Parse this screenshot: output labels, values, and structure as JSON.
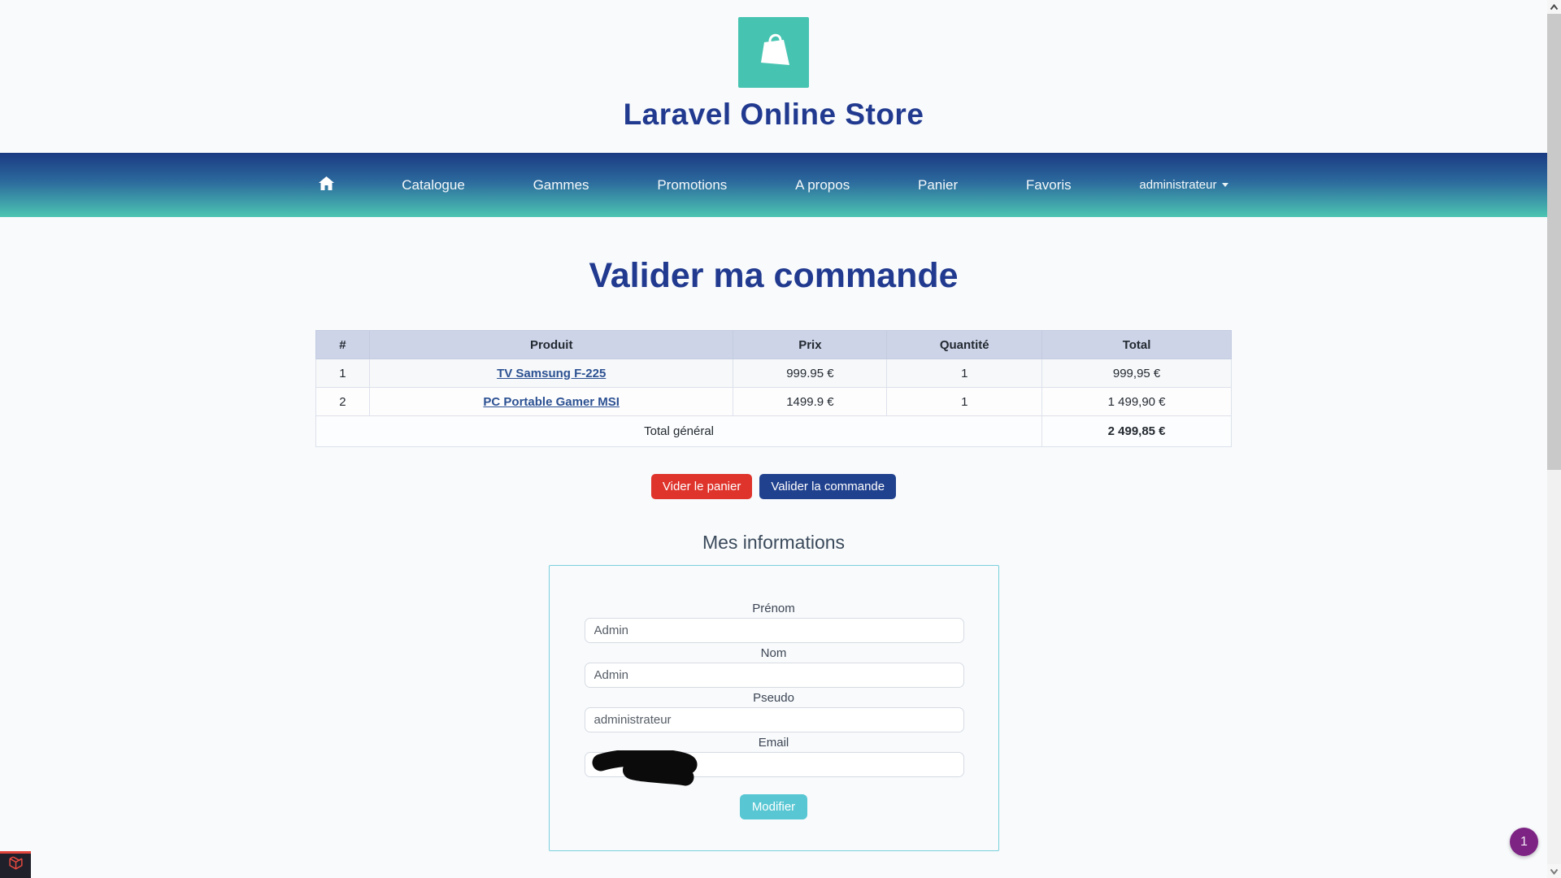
{
  "brand": {
    "title": "Laravel Online Store"
  },
  "navbar": {
    "items": [
      {
        "label": "Catalogue"
      },
      {
        "label": "Gammes"
      },
      {
        "label": "Promotions"
      },
      {
        "label": "A propos"
      },
      {
        "label": "Panier"
      },
      {
        "label": "Favoris"
      }
    ],
    "user_menu": {
      "label": "administrateur"
    }
  },
  "page": {
    "title": "Valider ma commande"
  },
  "cart_table": {
    "headers": [
      "#",
      "Produit",
      "Prix",
      "Quantité",
      "Total"
    ],
    "rows": [
      {
        "index": "1",
        "product": "TV Samsung F-225",
        "price": "999.95 €",
        "quantity": "1",
        "total": "999,95 €"
      },
      {
        "index": "2",
        "product": "PC Portable Gamer MSI",
        "price": "1499.9 €",
        "quantity": "1",
        "total": "1 499,90 €"
      }
    ],
    "footer": {
      "label": "Total général",
      "grand_total": "2 499,85 €"
    }
  },
  "actions": {
    "clear_cart_label": "Vider le panier",
    "validate_order_label": "Valider la commande"
  },
  "user_info": {
    "title": "Mes informations",
    "fields": [
      {
        "label": "Prénom",
        "value": "Admin"
      },
      {
        "label": "Nom",
        "value": "Admin"
      },
      {
        "label": "Pseudo",
        "value": "administrateur"
      },
      {
        "label": "Email",
        "value": ""
      }
    ],
    "email_redacted": true,
    "submit_label": "Modifier"
  },
  "floating": {
    "chat_badge_count": "1"
  },
  "colors": {
    "brand_blue": "#213a8f",
    "navbar_gradient_top": "#1a3a82",
    "navbar_gradient_bottom": "#4cc5b2",
    "logo_teal": "#47c4b1",
    "table_header_bg": "#cdd4e8",
    "link_blue": "#2c5192",
    "danger_red": "#df342c",
    "primary_blue": "#20418e",
    "modify_teal": "#58c7d3",
    "form_border_teal": "#7ad0dc",
    "chat_badge_purple": "#7d2384",
    "debugbar_red": "#e0443a"
  }
}
